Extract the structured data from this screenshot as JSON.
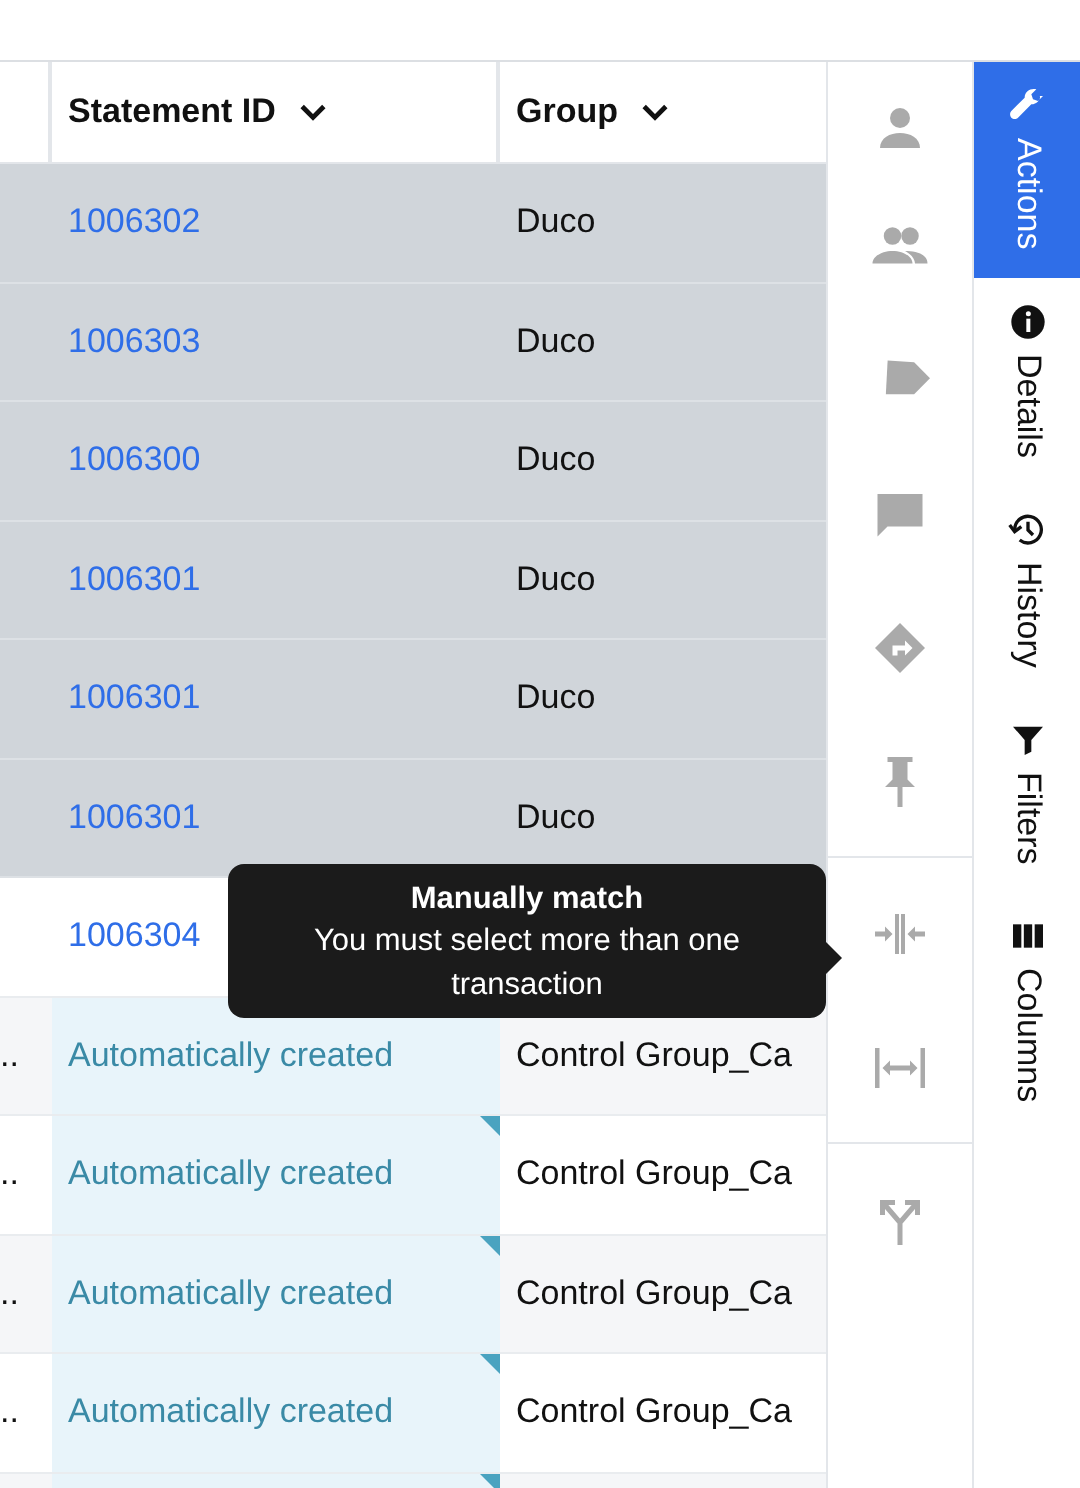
{
  "table": {
    "columns": [
      {
        "label": "Statement ID",
        "sortable": true
      },
      {
        "label": "Group",
        "sortable": true
      }
    ],
    "rows": [
      {
        "statement": "1006302",
        "group": "Duco",
        "selected": true,
        "kind": "link"
      },
      {
        "statement": "1006303",
        "group": "Duco",
        "selected": true,
        "kind": "link"
      },
      {
        "statement": "1006300",
        "group": "Duco",
        "selected": true,
        "kind": "link"
      },
      {
        "statement": "1006301",
        "group": "Duco",
        "selected": true,
        "kind": "link"
      },
      {
        "statement": "1006301",
        "group": "Duco",
        "selected": true,
        "kind": "link"
      },
      {
        "statement": "1006301",
        "group": "Duco",
        "selected": true,
        "kind": "link"
      },
      {
        "statement": "1006304",
        "selected": false,
        "kind": "link"
      },
      {
        "lead": "..",
        "statement": "Automatically created",
        "group": "Control Group_Ca",
        "selected": false,
        "kind": "auto"
      },
      {
        "lead": "..",
        "statement": "Automatically created",
        "group": "Control Group_Ca",
        "selected": false,
        "kind": "auto",
        "flagged": true
      },
      {
        "lead": "..",
        "statement": "Automatically created",
        "group": "Control Group_Ca",
        "selected": false,
        "kind": "auto",
        "flagged": true
      },
      {
        "lead": "..",
        "statement": "Automatically created",
        "group": "Control Group_Ca",
        "selected": false,
        "kind": "auto",
        "flagged": true
      }
    ]
  },
  "toolbar": [
    {
      "kind": "person"
    },
    {
      "kind": "people"
    },
    {
      "kind": "tag"
    },
    {
      "kind": "comment"
    },
    {
      "kind": "route"
    },
    {
      "kind": "pin",
      "divider": true
    },
    {
      "kind": "merge"
    },
    {
      "kind": "split",
      "divider": true
    },
    {
      "kind": "fork"
    }
  ],
  "tooltip": {
    "title": "Manually match",
    "text": "You must select more than one transaction"
  },
  "side_tabs": [
    {
      "label": "Actions",
      "kind": "wrench",
      "selected": true
    },
    {
      "label": "Details",
      "kind": "info",
      "selected": false
    },
    {
      "label": "History",
      "kind": "history",
      "selected": false
    },
    {
      "label": "Filters",
      "kind": "filter",
      "selected": false
    },
    {
      "label": "Columns",
      "kind": "columns",
      "selected": false
    }
  ]
}
